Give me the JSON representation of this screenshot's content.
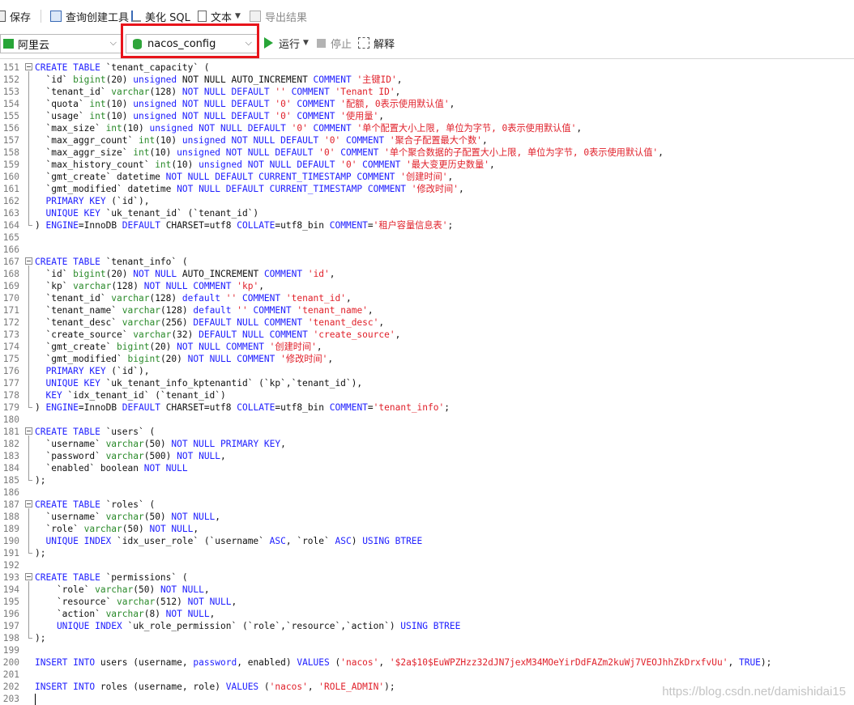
{
  "toolbar": {
    "save": "保存",
    "query_builder": "查询创建工具",
    "beautify_sql": "美化 SQL",
    "text": "文本",
    "export_result": "导出结果"
  },
  "connection_select": {
    "value": "阿里云"
  },
  "database_select": {
    "value": "nacos_config"
  },
  "run_label": "运行",
  "stop_label": "停止",
  "explain_label": "解释",
  "colors": {
    "highlight_box": "#e8141b",
    "keyword": "#2020ff",
    "type": "#2a8a2a",
    "string": "#e0202a"
  },
  "watermark": "https://blog.csdn.net/damishidai15",
  "editor": {
    "lines": [
      {
        "n": "151",
        "tokens": [
          [
            "k",
            "CREATE TABLE "
          ],
          [
            "p",
            "`tenant_capacity` ("
          ]
        ]
      },
      {
        "n": "152",
        "tokens": [
          [
            "p",
            "  `id` "
          ],
          [
            "t",
            "bigint"
          ],
          [
            "p",
            "(20) "
          ],
          [
            "k",
            "unsigned "
          ],
          [
            "p",
            "NOT NULL AUTO_INCREMENT "
          ],
          [
            "k",
            "COMMENT "
          ],
          [
            "s",
            "'主键ID'"
          ],
          [
            "p",
            ","
          ]
        ]
      },
      {
        "n": "153",
        "tokens": [
          [
            "p",
            "  `tenant_id` "
          ],
          [
            "t",
            "varchar"
          ],
          [
            "p",
            "(128) "
          ],
          [
            "k",
            "NOT NULL DEFAULT "
          ],
          [
            "s",
            "'' "
          ],
          [
            "k",
            "COMMENT "
          ],
          [
            "s",
            "'Tenant ID'"
          ],
          [
            "p",
            ","
          ]
        ]
      },
      {
        "n": "154",
        "tokens": [
          [
            "p",
            "  `quota` "
          ],
          [
            "t",
            "int"
          ],
          [
            "p",
            "(10) "
          ],
          [
            "k",
            "unsigned NOT NULL DEFAULT "
          ],
          [
            "s",
            "'0' "
          ],
          [
            "k",
            "COMMENT "
          ],
          [
            "s",
            "'配额, 0表示使用默认值'"
          ],
          [
            "p",
            ","
          ]
        ]
      },
      {
        "n": "155",
        "tokens": [
          [
            "p",
            "  `usage` "
          ],
          [
            "t",
            "int"
          ],
          [
            "p",
            "(10) "
          ],
          [
            "k",
            "unsigned NOT NULL DEFAULT "
          ],
          [
            "s",
            "'0' "
          ],
          [
            "k",
            "COMMENT "
          ],
          [
            "s",
            "'使用量'"
          ],
          [
            "p",
            ","
          ]
        ]
      },
      {
        "n": "156",
        "tokens": [
          [
            "p",
            "  `max_size` "
          ],
          [
            "t",
            "int"
          ],
          [
            "p",
            "(10) "
          ],
          [
            "k",
            "unsigned NOT NULL DEFAULT "
          ],
          [
            "s",
            "'0' "
          ],
          [
            "k",
            "COMMENT "
          ],
          [
            "s",
            "'单个配置大小上限, 单位为字节, 0表示使用默认值'"
          ],
          [
            "p",
            ","
          ]
        ]
      },
      {
        "n": "157",
        "tokens": [
          [
            "p",
            "  `max_aggr_count` "
          ],
          [
            "t",
            "int"
          ],
          [
            "p",
            "(10) "
          ],
          [
            "k",
            "unsigned NOT NULL DEFAULT "
          ],
          [
            "s",
            "'0' "
          ],
          [
            "k",
            "COMMENT "
          ],
          [
            "s",
            "'聚合子配置最大个数'"
          ],
          [
            "p",
            ","
          ]
        ]
      },
      {
        "n": "158",
        "tokens": [
          [
            "p",
            "  `max_aggr_size` "
          ],
          [
            "t",
            "int"
          ],
          [
            "p",
            "(10) "
          ],
          [
            "k",
            "unsigned NOT NULL DEFAULT "
          ],
          [
            "s",
            "'0' "
          ],
          [
            "k",
            "COMMENT "
          ],
          [
            "s",
            "'单个聚合数据的子配置大小上限, 单位为字节, 0表示使用默认值'"
          ],
          [
            "p",
            ","
          ]
        ]
      },
      {
        "n": "159",
        "tokens": [
          [
            "p",
            "  `max_history_count` "
          ],
          [
            "t",
            "int"
          ],
          [
            "p",
            "(10) "
          ],
          [
            "k",
            "unsigned NOT NULL DEFAULT "
          ],
          [
            "s",
            "'0' "
          ],
          [
            "k",
            "COMMENT "
          ],
          [
            "s",
            "'最大变更历史数量'"
          ],
          [
            "p",
            ","
          ]
        ]
      },
      {
        "n": "160",
        "tokens": [
          [
            "p",
            "  `gmt_create` datetime "
          ],
          [
            "k",
            "NOT NULL DEFAULT CURRENT_TIMESTAMP COMMENT "
          ],
          [
            "s",
            "'创建时间'"
          ],
          [
            "p",
            ","
          ]
        ]
      },
      {
        "n": "161",
        "tokens": [
          [
            "p",
            "  `gmt_modified` datetime "
          ],
          [
            "k",
            "NOT NULL DEFAULT CURRENT_TIMESTAMP COMMENT "
          ],
          [
            "s",
            "'修改时间'"
          ],
          [
            "p",
            ","
          ]
        ]
      },
      {
        "n": "162",
        "tokens": [
          [
            "k",
            "  PRIMARY KEY "
          ],
          [
            "p",
            "(`id`),"
          ]
        ]
      },
      {
        "n": "163",
        "tokens": [
          [
            "k",
            "  UNIQUE KEY "
          ],
          [
            "p",
            "`uk_tenant_id` (`tenant_id`)"
          ]
        ]
      },
      {
        "n": "164",
        "tokens": [
          [
            "p",
            ") "
          ],
          [
            "k",
            "ENGINE"
          ],
          [
            "p",
            "=InnoDB "
          ],
          [
            "k",
            "DEFAULT "
          ],
          [
            "p",
            "CHARSET=utf8 "
          ],
          [
            "k",
            "COLLATE"
          ],
          [
            "p",
            "=utf8_bin "
          ],
          [
            "k",
            "COMMENT"
          ],
          [
            "p",
            "="
          ],
          [
            "s",
            "'租户容量信息表'"
          ],
          [
            "p",
            ";"
          ]
        ]
      },
      {
        "n": "165",
        "tokens": []
      },
      {
        "n": "166",
        "tokens": []
      },
      {
        "n": "167",
        "tokens": [
          [
            "k",
            "CREATE TABLE "
          ],
          [
            "p",
            "`tenant_info` ("
          ]
        ]
      },
      {
        "n": "168",
        "tokens": [
          [
            "p",
            "  `id` "
          ],
          [
            "t",
            "bigint"
          ],
          [
            "p",
            "(20) "
          ],
          [
            "k",
            "NOT NULL "
          ],
          [
            "p",
            "AUTO_INCREMENT "
          ],
          [
            "k",
            "COMMENT "
          ],
          [
            "s",
            "'id'"
          ],
          [
            "p",
            ","
          ]
        ]
      },
      {
        "n": "169",
        "tokens": [
          [
            "p",
            "  `kp` "
          ],
          [
            "t",
            "varchar"
          ],
          [
            "p",
            "(128) "
          ],
          [
            "k",
            "NOT NULL COMMENT "
          ],
          [
            "s",
            "'kp'"
          ],
          [
            "p",
            ","
          ]
        ]
      },
      {
        "n": "170",
        "tokens": [
          [
            "p",
            "  `tenant_id` "
          ],
          [
            "t",
            "varchar"
          ],
          [
            "p",
            "(128) "
          ],
          [
            "k",
            "default "
          ],
          [
            "s",
            "'' "
          ],
          [
            "k",
            "COMMENT "
          ],
          [
            "s",
            "'tenant_id'"
          ],
          [
            "p",
            ","
          ]
        ]
      },
      {
        "n": "171",
        "tokens": [
          [
            "p",
            "  `tenant_name` "
          ],
          [
            "t",
            "varchar"
          ],
          [
            "p",
            "(128) "
          ],
          [
            "k",
            "default "
          ],
          [
            "s",
            "'' "
          ],
          [
            "k",
            "COMMENT "
          ],
          [
            "s",
            "'tenant_name'"
          ],
          [
            "p",
            ","
          ]
        ]
      },
      {
        "n": "172",
        "tokens": [
          [
            "p",
            "  `tenant_desc` "
          ],
          [
            "t",
            "varchar"
          ],
          [
            "p",
            "(256) "
          ],
          [
            "k",
            "DEFAULT NULL COMMENT "
          ],
          [
            "s",
            "'tenant_desc'"
          ],
          [
            "p",
            ","
          ]
        ]
      },
      {
        "n": "173",
        "tokens": [
          [
            "p",
            "  `create_source` "
          ],
          [
            "t",
            "varchar"
          ],
          [
            "p",
            "(32) "
          ],
          [
            "k",
            "DEFAULT NULL COMMENT "
          ],
          [
            "s",
            "'create_source'"
          ],
          [
            "p",
            ","
          ]
        ]
      },
      {
        "n": "174",
        "tokens": [
          [
            "p",
            "  `gmt_create` "
          ],
          [
            "t",
            "bigint"
          ],
          [
            "p",
            "(20) "
          ],
          [
            "k",
            "NOT NULL COMMENT "
          ],
          [
            "s",
            "'创建时间'"
          ],
          [
            "p",
            ","
          ]
        ]
      },
      {
        "n": "175",
        "tokens": [
          [
            "p",
            "  `gmt_modified` "
          ],
          [
            "t",
            "bigint"
          ],
          [
            "p",
            "(20) "
          ],
          [
            "k",
            "NOT NULL COMMENT "
          ],
          [
            "s",
            "'修改时间'"
          ],
          [
            "p",
            ","
          ]
        ]
      },
      {
        "n": "176",
        "tokens": [
          [
            "k",
            "  PRIMARY KEY "
          ],
          [
            "p",
            "(`id`),"
          ]
        ]
      },
      {
        "n": "177",
        "tokens": [
          [
            "k",
            "  UNIQUE KEY "
          ],
          [
            "p",
            "`uk_tenant_info_kptenantid` (`kp`,`tenant_id`),"
          ]
        ]
      },
      {
        "n": "178",
        "tokens": [
          [
            "k",
            "  KEY "
          ],
          [
            "p",
            "`idx_tenant_id` (`tenant_id`)"
          ]
        ]
      },
      {
        "n": "179",
        "tokens": [
          [
            "p",
            ") "
          ],
          [
            "k",
            "ENGINE"
          ],
          [
            "p",
            "=InnoDB "
          ],
          [
            "k",
            "DEFAULT "
          ],
          [
            "p",
            "CHARSET=utf8 "
          ],
          [
            "k",
            "COLLATE"
          ],
          [
            "p",
            "=utf8_bin "
          ],
          [
            "k",
            "COMMENT"
          ],
          [
            "p",
            "="
          ],
          [
            "s",
            "'tenant_info'"
          ],
          [
            "p",
            ";"
          ]
        ]
      },
      {
        "n": "180",
        "tokens": []
      },
      {
        "n": "181",
        "tokens": [
          [
            "k",
            "CREATE TABLE "
          ],
          [
            "p",
            "`users` ("
          ]
        ]
      },
      {
        "n": "182",
        "tokens": [
          [
            "p",
            "  `username` "
          ],
          [
            "t",
            "varchar"
          ],
          [
            "p",
            "(50) "
          ],
          [
            "k",
            "NOT NULL PRIMARY KEY"
          ],
          [
            "p",
            ","
          ]
        ]
      },
      {
        "n": "183",
        "tokens": [
          [
            "p",
            "  `password` "
          ],
          [
            "t",
            "varchar"
          ],
          [
            "p",
            "(500) "
          ],
          [
            "k",
            "NOT NULL"
          ],
          [
            "p",
            ","
          ]
        ]
      },
      {
        "n": "184",
        "tokens": [
          [
            "p",
            "  `enabled` boolean "
          ],
          [
            "k",
            "NOT NULL"
          ]
        ]
      },
      {
        "n": "185",
        "tokens": [
          [
            "p",
            ");"
          ]
        ]
      },
      {
        "n": "186",
        "tokens": []
      },
      {
        "n": "187",
        "tokens": [
          [
            "k",
            "CREATE TABLE "
          ],
          [
            "p",
            "`roles` ("
          ]
        ]
      },
      {
        "n": "188",
        "tokens": [
          [
            "p",
            "  `username` "
          ],
          [
            "t",
            "varchar"
          ],
          [
            "p",
            "(50) "
          ],
          [
            "k",
            "NOT NULL"
          ],
          [
            "p",
            ","
          ]
        ]
      },
      {
        "n": "189",
        "tokens": [
          [
            "p",
            "  `role` "
          ],
          [
            "t",
            "varchar"
          ],
          [
            "p",
            "(50) "
          ],
          [
            "k",
            "NOT NULL"
          ],
          [
            "p",
            ","
          ]
        ]
      },
      {
        "n": "190",
        "tokens": [
          [
            "k",
            "  UNIQUE INDEX "
          ],
          [
            "p",
            "`idx_user_role` (`username` "
          ],
          [
            "k",
            "ASC"
          ],
          [
            "p",
            ", `role` "
          ],
          [
            "k",
            "ASC"
          ],
          [
            "p",
            ") "
          ],
          [
            "k",
            "USING BTREE"
          ]
        ]
      },
      {
        "n": "191",
        "tokens": [
          [
            "p",
            ");"
          ]
        ]
      },
      {
        "n": "192",
        "tokens": []
      },
      {
        "n": "193",
        "tokens": [
          [
            "k",
            "CREATE TABLE "
          ],
          [
            "p",
            "`permissions` ("
          ]
        ]
      },
      {
        "n": "194",
        "tokens": [
          [
            "p",
            "    `role` "
          ],
          [
            "t",
            "varchar"
          ],
          [
            "p",
            "(50) "
          ],
          [
            "k",
            "NOT NULL"
          ],
          [
            "p",
            ","
          ]
        ]
      },
      {
        "n": "195",
        "tokens": [
          [
            "p",
            "    `resource` "
          ],
          [
            "t",
            "varchar"
          ],
          [
            "p",
            "(512) "
          ],
          [
            "k",
            "NOT NULL"
          ],
          [
            "p",
            ","
          ]
        ]
      },
      {
        "n": "196",
        "tokens": [
          [
            "p",
            "    `action` "
          ],
          [
            "t",
            "varchar"
          ],
          [
            "p",
            "(8) "
          ],
          [
            "k",
            "NOT NULL"
          ],
          [
            "p",
            ","
          ]
        ]
      },
      {
        "n": "197",
        "tokens": [
          [
            "k",
            "    UNIQUE INDEX "
          ],
          [
            "p",
            "`uk_role_permission` (`role`,`resource`,`action`) "
          ],
          [
            "k",
            "USING BTREE"
          ]
        ]
      },
      {
        "n": "198",
        "tokens": [
          [
            "p",
            ");"
          ]
        ]
      },
      {
        "n": "199",
        "tokens": []
      },
      {
        "n": "200",
        "tokens": [
          [
            "k",
            "INSERT INTO "
          ],
          [
            "p",
            "users (username, "
          ],
          [
            "k",
            "password"
          ],
          [
            "p",
            ", enabled) "
          ],
          [
            "k",
            "VALUES "
          ],
          [
            "p",
            "("
          ],
          [
            "s",
            "'nacos'"
          ],
          [
            "p",
            ", "
          ],
          [
            "s",
            "'$2a$10$EuWPZHzz32dJN7jexM34MOeYirDdFAZm2kuWj7VEOJhhZkDrxfvUu'"
          ],
          [
            "p",
            ", "
          ],
          [
            "k",
            "TRUE"
          ],
          [
            "p",
            ");"
          ]
        ]
      },
      {
        "n": "201",
        "tokens": []
      },
      {
        "n": "202",
        "tokens": [
          [
            "k",
            "INSERT INTO "
          ],
          [
            "p",
            "roles (username, role) "
          ],
          [
            "k",
            "VALUES "
          ],
          [
            "p",
            "("
          ],
          [
            "s",
            "'nacos'"
          ],
          [
            "p",
            ", "
          ],
          [
            "s",
            "'ROLE_ADMIN'"
          ],
          [
            "p",
            ");"
          ]
        ]
      },
      {
        "n": "203",
        "tokens": []
      }
    ]
  }
}
